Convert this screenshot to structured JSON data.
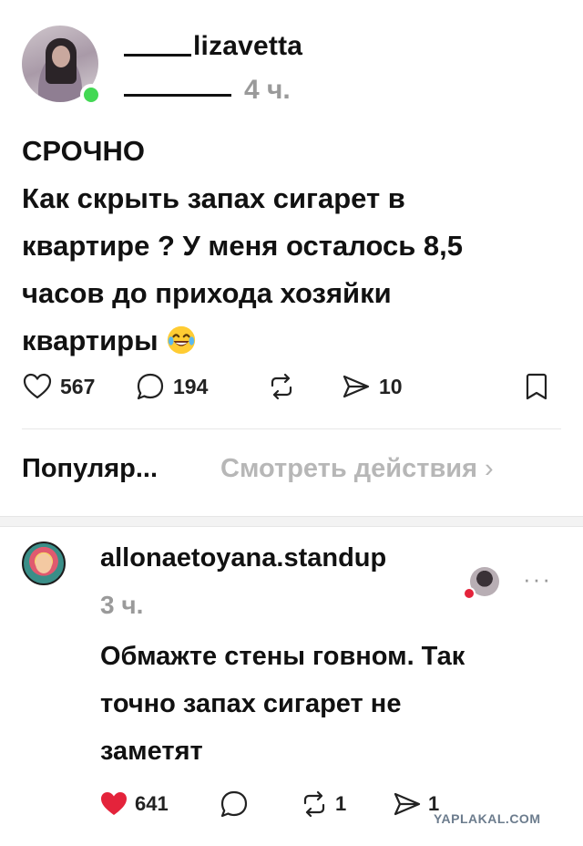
{
  "post": {
    "username": "lizavetta",
    "time": "4 ч.",
    "lines": [
      "СРОЧНО",
      "Как скрыть запах сигарет в",
      "квартире ? У меня осталось 8,5",
      "часов до прихода хозяйки",
      "квартиры"
    ],
    "emoji": "laughing-tears-emoji",
    "likes": "567",
    "comments": "194",
    "shares": "10"
  },
  "sort": {
    "label": "Популяр...",
    "view_activity": "Смотреть действия"
  },
  "comment": {
    "username": "allonaetoyana.standup",
    "time": "3 ч.",
    "lines": [
      "Обмажте стены говном. Так",
      "точно запах сигарет не",
      "заметят"
    ],
    "likes": "641",
    "reposts": "1",
    "shares": "1"
  },
  "colors": {
    "like_red": "#e4233b",
    "online_green": "#43d854",
    "muted": "#9a9a9a"
  },
  "watermark": "YAPLAKAL.COM"
}
